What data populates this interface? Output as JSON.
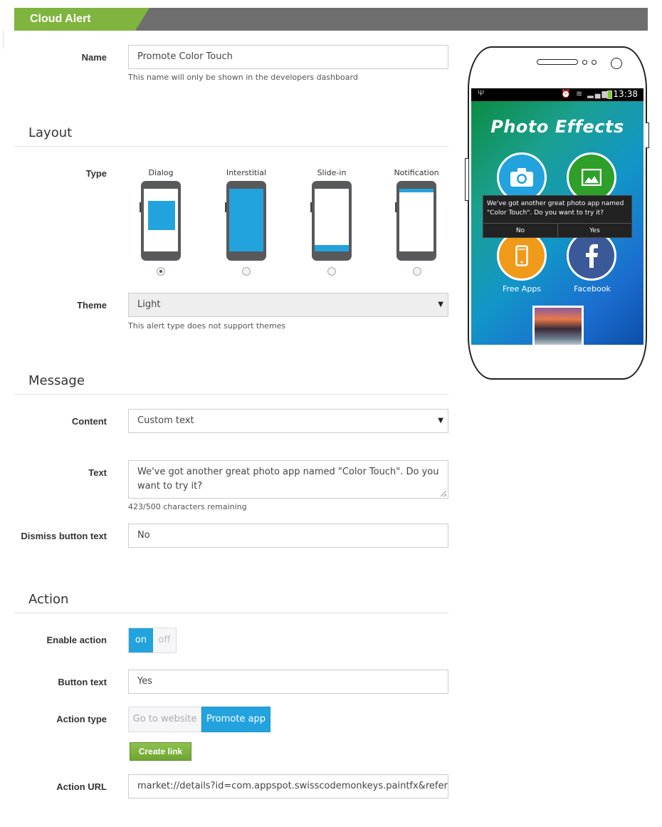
{
  "header": {
    "title": "Cloud Alert"
  },
  "name": {
    "label": "Name",
    "value": "Promote Color Touch",
    "help": "This name will only be shown in the developers dashboard"
  },
  "layout": {
    "section_title": "Layout",
    "type_label": "Type",
    "types": [
      {
        "label": "Dialog",
        "selected": true
      },
      {
        "label": "Interstitial",
        "selected": false
      },
      {
        "label": "Slide-in",
        "selected": false
      },
      {
        "label": "Notification",
        "selected": false
      }
    ],
    "theme_label": "Theme",
    "theme_value": "Light",
    "theme_help": "This alert type does not support themes"
  },
  "message": {
    "section_title": "Message",
    "content_label": "Content",
    "content_value": "Custom text",
    "text_label": "Text",
    "text_value": "We've got another great photo app named \"Color Touch\". Do you want to try it?",
    "text_help": "423/500 characters remaining",
    "dismiss_label": "Dismiss button text",
    "dismiss_value": "No"
  },
  "action": {
    "section_title": "Action",
    "enable_label": "Enable action",
    "toggle_on": "on",
    "toggle_off": "off",
    "button_text_label": "Button text",
    "button_text_value": "Yes",
    "action_type_label": "Action type",
    "action_type_options": [
      "Go to website",
      "Promote app"
    ],
    "action_type_selected": "Promote app",
    "create_link": "Create link",
    "url_label": "Action URL",
    "url_value": "market://details?id=com.appspot.swisscodemonkeys.paintfx&referrer="
  },
  "preview": {
    "status_time": "13:38",
    "app_title": "Photo Effects",
    "dialog_text": "We've got another great photo app named \"Color Touch\". Do you want to try it?",
    "dialog_no": "No",
    "dialog_yes": "Yes",
    "caption_free_apps": "Free Apps",
    "caption_facebook": "Facebook"
  },
  "colors": {
    "accent_blue": "#23a3dd",
    "header_green": "#7fb43e",
    "header_gray": "#6e6e6e",
    "create_link_green": "#7ab33f"
  }
}
